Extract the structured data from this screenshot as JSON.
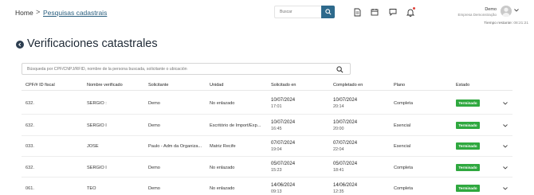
{
  "breadcrumb": {
    "home": "Home",
    "separator": ">",
    "current": "Pesquisas cadastrais"
  },
  "top_search": {
    "placeholder": "Buscar"
  },
  "user": {
    "name": "Demo",
    "company": "Empresa Demonstração"
  },
  "session": {
    "time_label": "Tiempo restante:",
    "time_value": "08:21:21"
  },
  "page": {
    "title": "Verificaciones catastrales"
  },
  "main_search": {
    "placeholder": "Búsqueda por CPF/CNPJ/RFID, nombre de la persona buscada, solicitante o ubicación"
  },
  "table": {
    "headers": {
      "id": "CPF/# ID fiscal",
      "name": "Nombre verificado",
      "requester": "Solicitante",
      "unit": "Unidad",
      "requested": "Solicitado en",
      "completed": "Completado en",
      "plan": "Plano",
      "status": "Estado"
    },
    "rows": [
      {
        "id": "632.",
        "name": "SERGIO :",
        "requester": "Demo",
        "unit": "No enlazado",
        "req_date": "10/07/2024",
        "req_time": "17:01",
        "comp_date": "10/07/2024",
        "comp_time": "20:14",
        "plan": "Completa",
        "status": "Terminado"
      },
      {
        "id": "632.",
        "name": "SERGIO I",
        "requester": "Demo",
        "unit": "Escritório de Import/Exp...",
        "req_date": "10/07/2024",
        "req_time": "16:45",
        "comp_date": "10/07/2024",
        "comp_time": "20:00",
        "plan": "Esencial",
        "status": "Terminado"
      },
      {
        "id": "033.",
        "name": "JOSE",
        "requester": "Paulo - Adm da Organiza...",
        "unit": "Matriz Recife",
        "req_date": "07/07/2024",
        "req_time": "19:04",
        "comp_date": "07/07/2024",
        "comp_time": "22:04",
        "plan": "Esencial",
        "status": "Terminado"
      },
      {
        "id": "632.",
        "name": "SERGIO I",
        "requester": "Demo",
        "unit": "No enlazado",
        "req_date": "05/07/2024",
        "req_time": "15:23",
        "comp_date": "05/07/2024",
        "comp_time": "18:41",
        "plan": "Completa",
        "status": "Terminado"
      },
      {
        "id": "061.",
        "name": "TEO",
        "requester": "Demo",
        "unit": "No enlazado",
        "req_date": "14/06/2024",
        "req_time": "09:13",
        "comp_date": "14/06/2024",
        "comp_time": "12:35",
        "plan": "Completa",
        "status": "Terminado"
      }
    ]
  },
  "colors": {
    "accent": "#2e6a8c",
    "status_green": "#2fa83f",
    "title_dark": "#1f2a36",
    "notification": "#e0413a"
  },
  "icons": [
    "search-icon",
    "document-icon",
    "calendar-icon",
    "chat-icon",
    "bell-icon",
    "user-avatar-icon",
    "chevron-down-icon",
    "back-arrow-icon"
  ]
}
